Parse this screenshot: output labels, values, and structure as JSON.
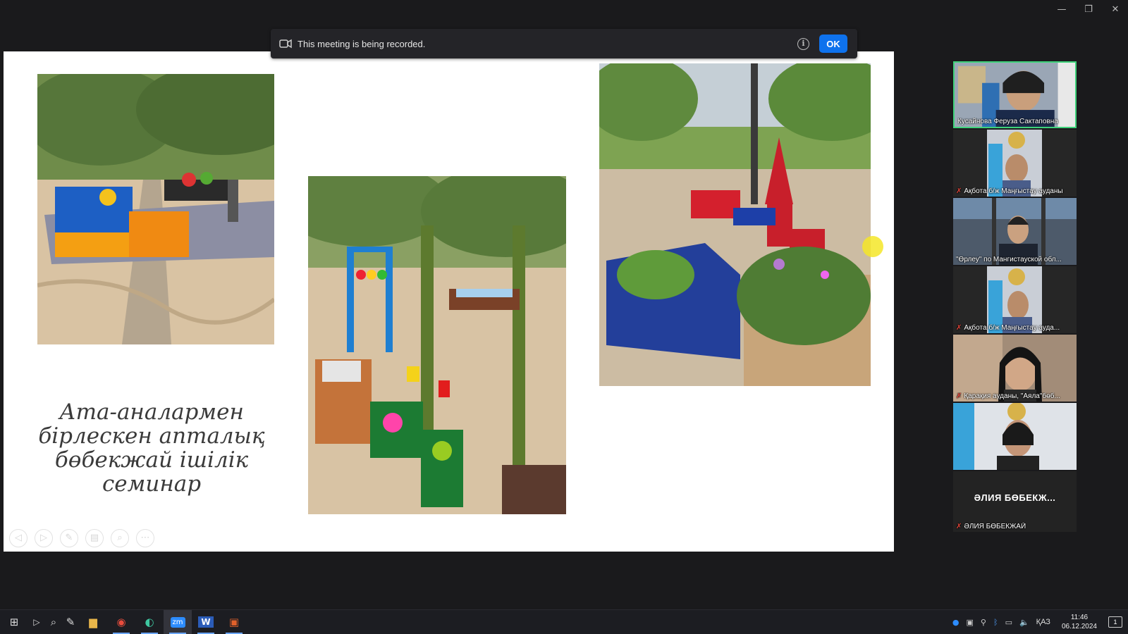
{
  "window": {
    "controls": [
      {
        "name": "minimize-icon",
        "glyph": "—"
      },
      {
        "name": "restore-icon",
        "glyph": "❐"
      },
      {
        "name": "close-icon",
        "glyph": "✕"
      }
    ]
  },
  "recording_banner": {
    "text": "This meeting is being recorded.",
    "info_icon": "i",
    "ok_label": "OK"
  },
  "slide": {
    "title_lines": [
      "Ата-аналармен",
      "бірлескен апталық",
      "бөбекжай ішілік",
      "семинар"
    ],
    "toolbar": [
      "◁",
      "▷",
      "✎",
      "▤",
      "⌕",
      "⋯"
    ],
    "photos": [
      "nature-corner-photo",
      "outdoor-play-area-photo",
      "garden-bed-photo"
    ]
  },
  "participants": [
    {
      "name": "Кусайнова Феруза Сактаповна",
      "muted": false,
      "active": true
    },
    {
      "name": "Ақбота б/ж Маңғыстау ауданы",
      "muted": true,
      "active": false
    },
    {
      "name": "\"Өрлеу\" по Мангистауской обл...",
      "muted": false,
      "active": false
    },
    {
      "name": "Ақбота б/ж Маңғыстау ауда...",
      "muted": true,
      "active": false
    },
    {
      "name": "Қарақия ауданы, \"Аяла\"бөб...",
      "muted": true,
      "active": false
    },
    {
      "name": "",
      "muted": false,
      "active": false
    },
    {
      "name": "ӘЛИЯ БӨБЕКЖАЙ",
      "display": "ӘЛИЯ БӨБЕКЖ...",
      "muted": true,
      "active": false
    }
  ],
  "taskbar": {
    "apps": [
      {
        "name": "start-icon",
        "glyph": "⊞"
      },
      {
        "name": "task-view-icon",
        "glyph": "▷"
      },
      {
        "name": "search-icon",
        "glyph": "⌕"
      },
      {
        "name": "pen-icon",
        "glyph": "✎"
      },
      {
        "name": "file-explorer-icon",
        "glyph": "▆"
      },
      {
        "name": "chrome-icon",
        "glyph": "◉"
      },
      {
        "name": "edge-icon",
        "glyph": "◐"
      },
      {
        "name": "zoom-icon",
        "glyph": "zm"
      },
      {
        "name": "word-icon",
        "glyph": "W"
      },
      {
        "name": "powerpoint-icon",
        "glyph": "▣"
      }
    ],
    "tray": {
      "language": "ҚАЗ",
      "time": "11:46",
      "date": "06.12.2024",
      "notifications": "1"
    }
  },
  "colors": {
    "ok_button": "#0e72ed",
    "active_speaker_border": "#3ed27a",
    "mute_icon": "#e0453a",
    "cursor_highlight": "#f5e628"
  }
}
